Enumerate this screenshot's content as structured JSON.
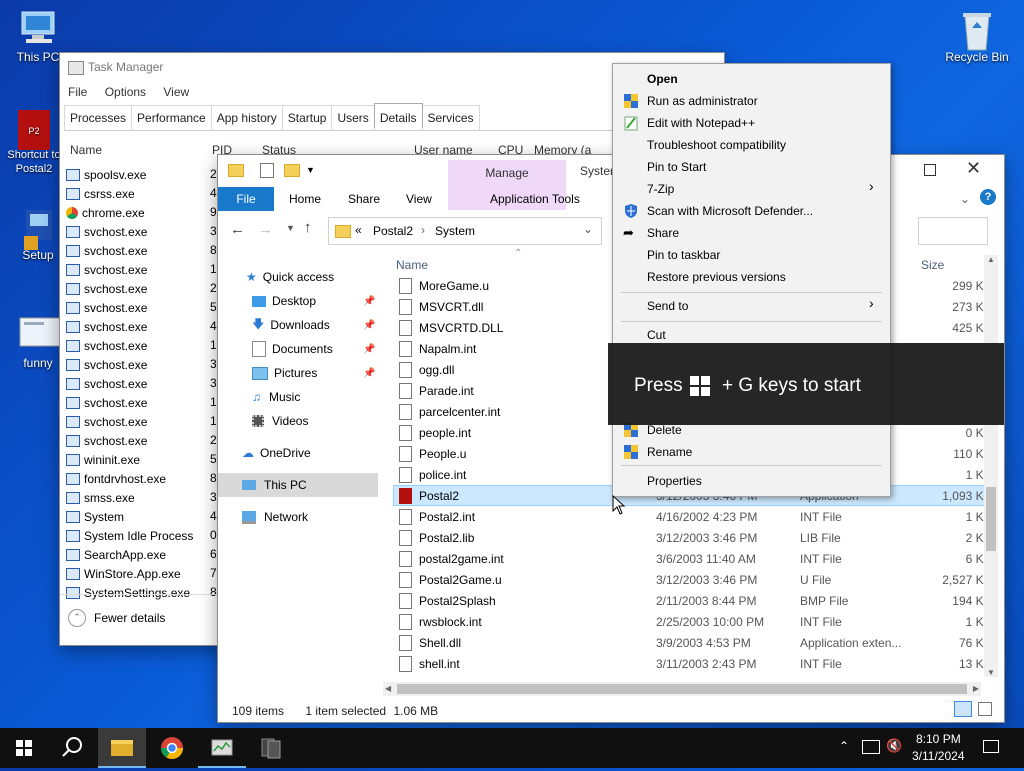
{
  "desktop": {
    "icons": [
      {
        "label": "This PC"
      },
      {
        "label": "Shortcut to Postal2"
      },
      {
        "label": "Setup"
      },
      {
        "label": "funny"
      },
      {
        "label": "Recycle Bin"
      }
    ]
  },
  "task_manager": {
    "title": "Task Manager",
    "menu": [
      "File",
      "Options",
      "View"
    ],
    "tabs": [
      "Processes",
      "Performance",
      "App history",
      "Startup",
      "Users",
      "Details",
      "Services"
    ],
    "active_tab": "Details",
    "columns": [
      "Name",
      "PID",
      "Status",
      "User name",
      "CPU",
      "Memory (a"
    ],
    "processes": [
      {
        "name": "spoolsv.exe",
        "pid": "2"
      },
      {
        "name": "csrss.exe",
        "pid": "4"
      },
      {
        "name": "chrome.exe",
        "pid": "9"
      },
      {
        "name": "svchost.exe",
        "pid": "3"
      },
      {
        "name": "svchost.exe",
        "pid": "8"
      },
      {
        "name": "svchost.exe",
        "pid": "1"
      },
      {
        "name": "svchost.exe",
        "pid": "2"
      },
      {
        "name": "svchost.exe",
        "pid": "5"
      },
      {
        "name": "svchost.exe",
        "pid": "4"
      },
      {
        "name": "svchost.exe",
        "pid": "1"
      },
      {
        "name": "svchost.exe",
        "pid": "3"
      },
      {
        "name": "svchost.exe",
        "pid": "3"
      },
      {
        "name": "svchost.exe",
        "pid": "1"
      },
      {
        "name": "svchost.exe",
        "pid": "1"
      },
      {
        "name": "svchost.exe",
        "pid": "2"
      },
      {
        "name": "wininit.exe",
        "pid": "5"
      },
      {
        "name": "fontdrvhost.exe",
        "pid": "8"
      },
      {
        "name": "smss.exe",
        "pid": "3"
      },
      {
        "name": "System",
        "pid": "4"
      },
      {
        "name": "System Idle Process",
        "pid": "0"
      },
      {
        "name": "SearchApp.exe",
        "pid": "6"
      },
      {
        "name": "WinStore.App.exe",
        "pid": "7"
      },
      {
        "name": "SystemSettings.exe",
        "pid": "8"
      }
    ],
    "fewer_details": "Fewer details"
  },
  "explorer": {
    "ribbon_tabs": [
      "File",
      "Home",
      "Share",
      "View"
    ],
    "contextual_group": "Manage",
    "contextual_tab": "Application Tools",
    "window_title_partial": "Syster",
    "breadcrumb": [
      "Postal2",
      "System"
    ],
    "nav": [
      {
        "label": "Quick access"
      },
      {
        "label": "Desktop"
      },
      {
        "label": "Downloads"
      },
      {
        "label": "Documents"
      },
      {
        "label": "Pictures"
      },
      {
        "label": "Music"
      },
      {
        "label": "Videos"
      },
      {
        "label": "OneDrive"
      },
      {
        "label": "This PC"
      },
      {
        "label": "Network"
      }
    ],
    "columns": {
      "name": "Name",
      "size": "Size"
    },
    "files": [
      {
        "name": "MoreGame.u",
        "date": "",
        "type": "",
        "size": "299 KI"
      },
      {
        "name": "MSVCRT.dll",
        "date": "",
        "type": "n...",
        "size": "273 KI"
      },
      {
        "name": "MSVCRTD.DLL",
        "date": "",
        "type": "n...",
        "size": "425 KI"
      },
      {
        "name": "Napalm.int",
        "date": "",
        "type": "",
        "size": ""
      },
      {
        "name": "ogg.dll",
        "date": "",
        "type": "",
        "size": ""
      },
      {
        "name": "Parade.int",
        "date": "",
        "type": "",
        "size": ""
      },
      {
        "name": "parcelcenter.int",
        "date": "",
        "type": "",
        "size": ""
      },
      {
        "name": "people.int",
        "date": "",
        "type": "",
        "size": "0 KI"
      },
      {
        "name": "People.u",
        "date": "",
        "type": "",
        "size": "110 KI"
      },
      {
        "name": "police.int",
        "date": "",
        "type": "",
        "size": "1 KI"
      },
      {
        "name": "Postal2",
        "date": "3/12/2003 3:46 PM",
        "type": "Application",
        "size": "1,093 KI"
      },
      {
        "name": "Postal2.int",
        "date": "4/16/2002 4:23 PM",
        "type": "INT File",
        "size": "1 KI"
      },
      {
        "name": "Postal2.lib",
        "date": "3/12/2003 3:46 PM",
        "type": "LIB File",
        "size": "2 KI"
      },
      {
        "name": "postal2game.int",
        "date": "3/6/2003 11:40 AM",
        "type": "INT File",
        "size": "6 KI"
      },
      {
        "name": "Postal2Game.u",
        "date": "3/12/2003 3:46 PM",
        "type": "U File",
        "size": "2,527 KI"
      },
      {
        "name": "Postal2Splash",
        "date": "2/11/2003 8:44 PM",
        "type": "BMP File",
        "size": "194 KI"
      },
      {
        "name": "rwsblock.int",
        "date": "2/25/2003 10:00 PM",
        "type": "INT File",
        "size": "1 KI"
      },
      {
        "name": "Shell.dll",
        "date": "3/9/2003 4:53 PM",
        "type": "Application exten...",
        "size": "76 KI"
      },
      {
        "name": "shell.int",
        "date": "3/11/2003 2:43 PM",
        "type": "INT File",
        "size": "13 KI"
      }
    ],
    "status": {
      "items": "109 items",
      "selected": "1 item selected",
      "size": "1.06 MB"
    }
  },
  "context_menu": {
    "items": [
      {
        "label": "Open"
      },
      {
        "label": "Run as administrator"
      },
      {
        "label": "Edit with Notepad++"
      },
      {
        "label": "Troubleshoot compatibility"
      },
      {
        "label": "Pin to Start"
      },
      {
        "label": "7-Zip"
      },
      {
        "label": "Scan with Microsoft Defender..."
      },
      {
        "label": "Share"
      },
      {
        "label": "Pin to taskbar"
      },
      {
        "label": "Restore previous versions"
      },
      {
        "label": "Send to"
      },
      {
        "label": "Cut"
      },
      {
        "label": "Delete"
      },
      {
        "label": "Rename"
      },
      {
        "label": "Properties"
      }
    ]
  },
  "toast": {
    "before": "Press",
    "after": "+ G keys to start"
  },
  "taskbar": {
    "time": "8:10 PM",
    "date": "3/11/2024"
  },
  "colors": {
    "accent": "#0078d7",
    "selection": "#cce8ff",
    "ribbon_manage": "#f0d8f8"
  }
}
